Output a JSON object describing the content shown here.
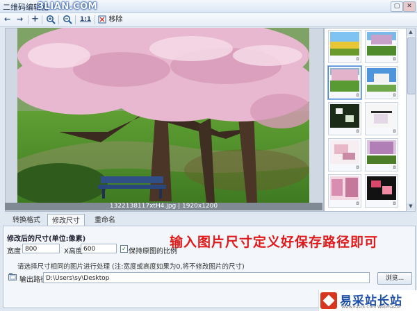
{
  "window": {
    "title": "二维码编辑器",
    "watermark": "3LIAN.COM",
    "controls": [
      "▢",
      "✕"
    ]
  },
  "toolbar": {
    "back": "←",
    "forward": "→",
    "add": "+",
    "zoom_in": "+",
    "zoom_out": "−",
    "actual_size": "1:1",
    "remove_label": "移除"
  },
  "viewer": {
    "caption": "1322138117xtH4.jpg | 1920x1200"
  },
  "thumbnails": [
    {
      "scene": "flowers-field",
      "selected": false
    },
    {
      "scene": "tree-purple",
      "selected": false
    },
    {
      "scene": "tree-park",
      "selected": true
    },
    {
      "scene": "sky-tree",
      "selected": false
    },
    {
      "scene": "dark-blossom",
      "selected": false
    },
    {
      "scene": "white-blossom",
      "selected": false
    },
    {
      "scene": "pink-blossom",
      "selected": false
    },
    {
      "scene": "purple-tree",
      "selected": false
    },
    {
      "scene": "pink-grove",
      "selected": false
    },
    {
      "scene": "red-blossom",
      "selected": false
    }
  ],
  "tabs": [
    "转换格式",
    "修改尺寸",
    "重命名"
  ],
  "resize": {
    "section_title": "修改后的尺寸(单位:像素)",
    "width_label": "宽度",
    "width_value": "800",
    "height_label": "X高度",
    "height_value": "600",
    "keep_ratio_label": "保持原图的比例",
    "keep_ratio_checked": true,
    "hint": "请选择尺寸相同的图片进行处理 (注:宽度或高度如果为0,将不修改图片的尺寸)",
    "output_label": "输出路径",
    "output_path": "D:\\Users\\sy\\Desktop",
    "browse_label": "浏览..."
  },
  "annotation": "输入图片尺寸定义好保存路径即可",
  "branding": {
    "name": "易采站长站",
    "url": "Www.Easck.Com Webmaster"
  },
  "colors": {
    "accent": "#3f7fd4",
    "annotation_red": "#e01a1a",
    "brand_blue": "#1d4fa6"
  }
}
